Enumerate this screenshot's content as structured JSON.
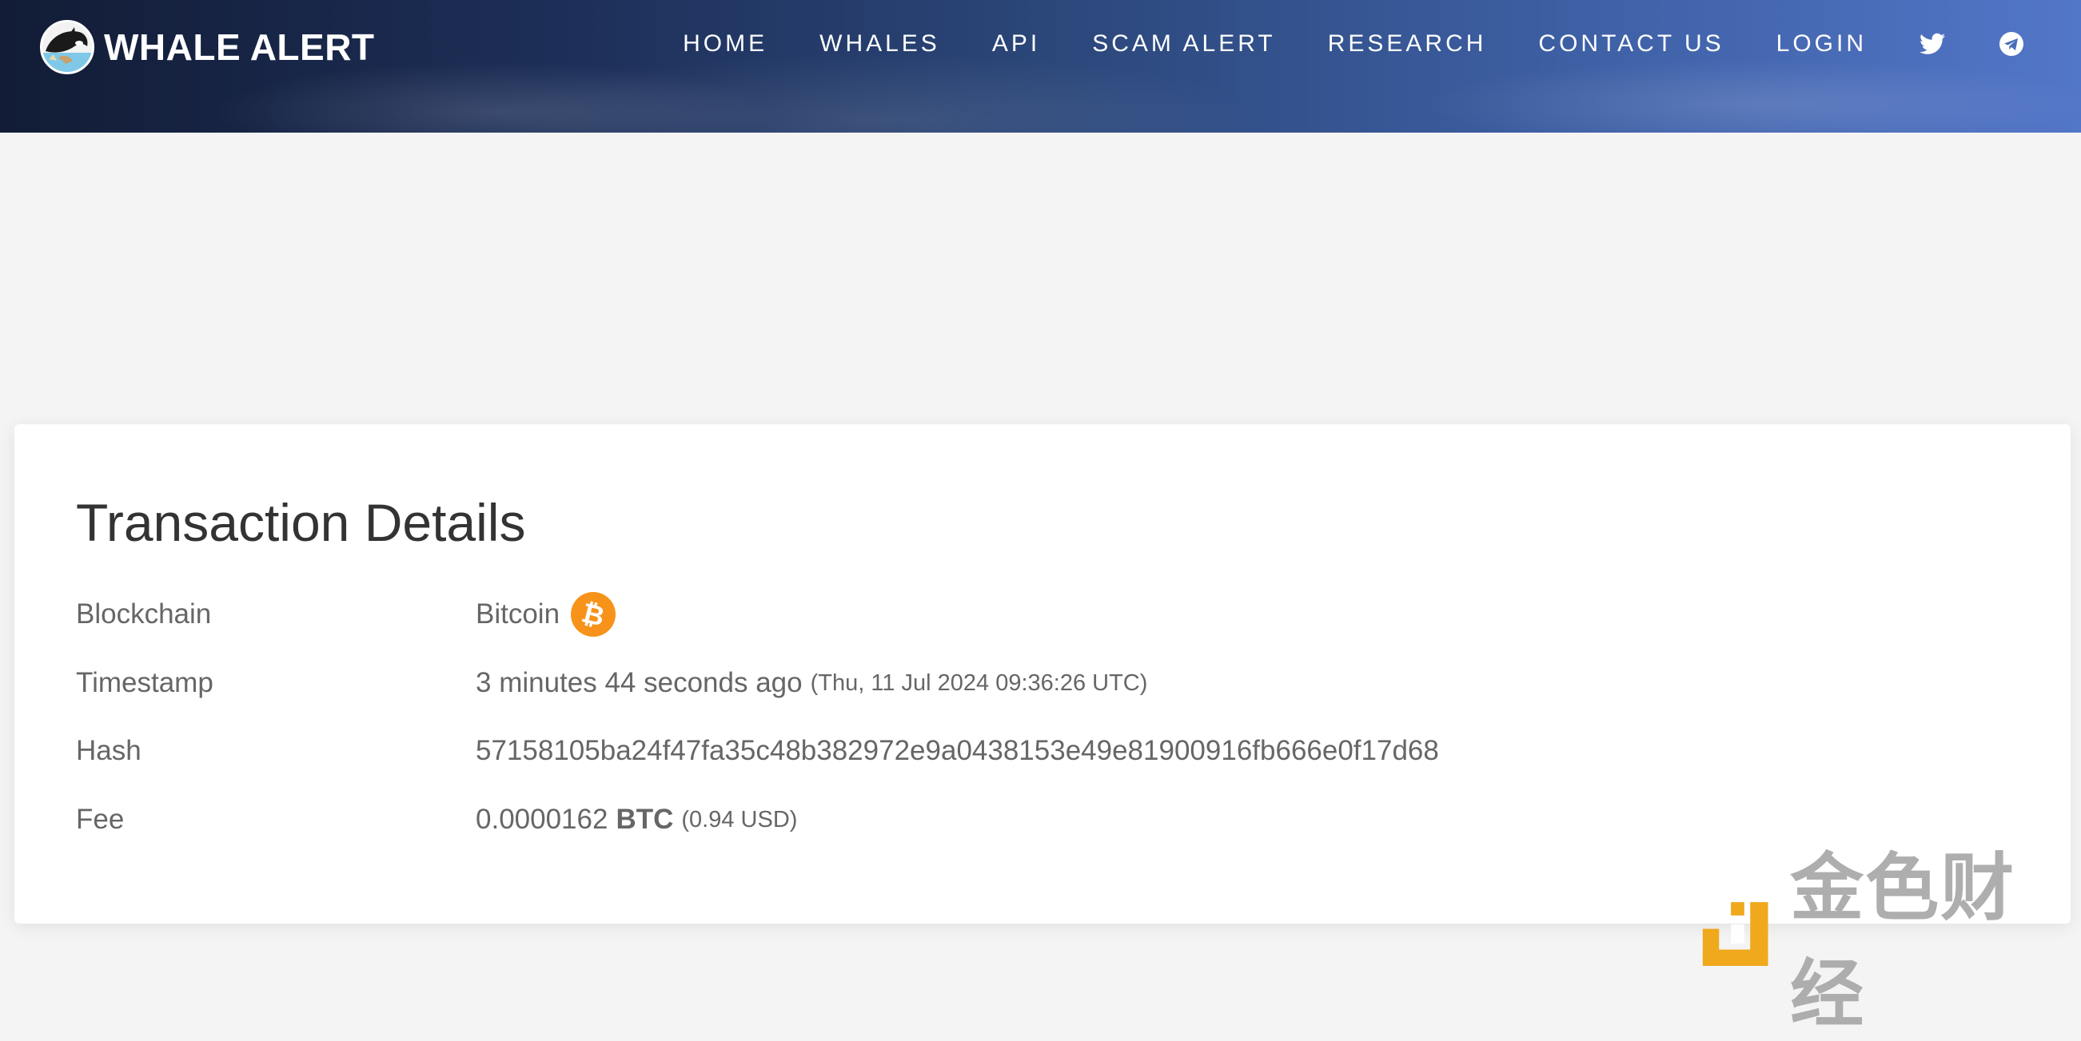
{
  "brand": {
    "name": "WHALE ALERT"
  },
  "nav": {
    "items": [
      "HOME",
      "WHALES",
      "API",
      "SCAM ALERT",
      "RESEARCH",
      "CONTACT US",
      "LOGIN"
    ],
    "icons": [
      "twitter-icon",
      "telegram-icon"
    ]
  },
  "transaction": {
    "title": "Transaction Details",
    "blockchain_label": "Blockchain",
    "blockchain_value": "Bitcoin",
    "timestamp_label": "Timestamp",
    "timestamp_relative": "3 minutes 44 seconds ago",
    "timestamp_absolute": "(Thu, 11 Jul 2024 09:36:26 UTC)",
    "hash_label": "Hash",
    "hash_value": "57158105ba24f47fa35c48b382972e9a0438153e49e81900916fb666e0f17d68",
    "fee_label": "Fee",
    "fee_amount": "0.0000162",
    "fee_unit": "BTC",
    "fee_usd": "(0.94 USD)"
  },
  "watermark": {
    "text": "金色财经"
  },
  "colors": {
    "hash_link": "#3aae6b",
    "bitcoin_orange": "#f7931a",
    "watermark_orange": "#f0a81c"
  }
}
